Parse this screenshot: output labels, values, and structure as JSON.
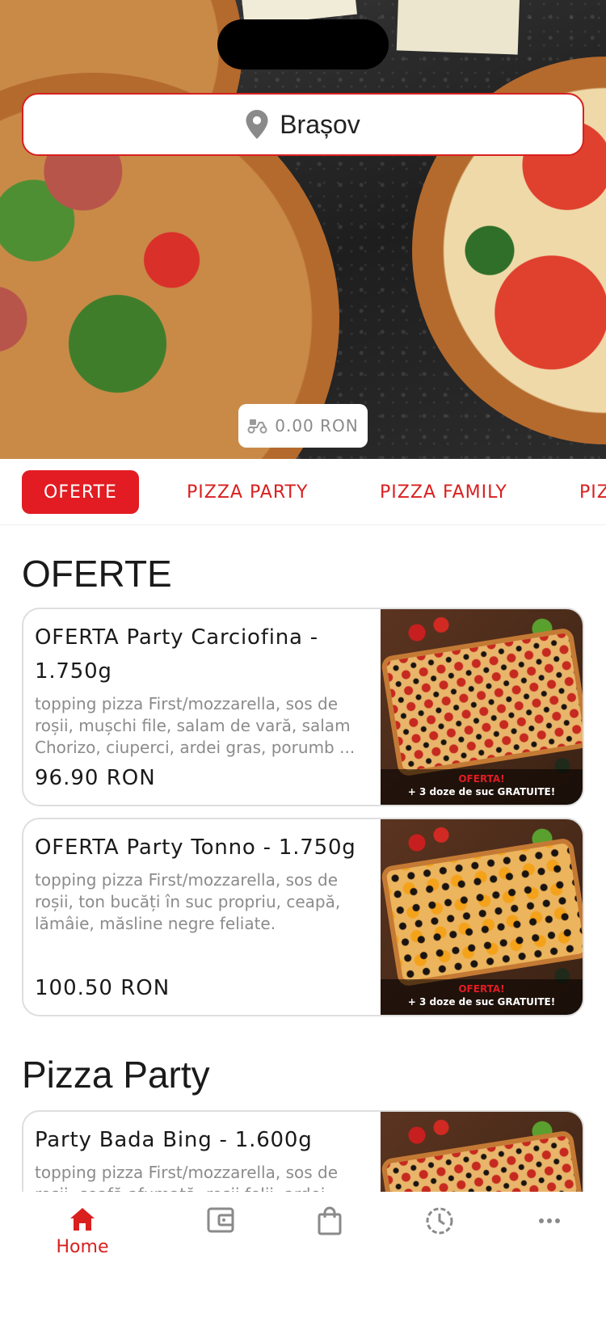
{
  "header": {
    "city": "Brașov",
    "cart_amount": "0.00 RON"
  },
  "tabs": [
    {
      "label": "OFERTE",
      "active": true
    },
    {
      "label": "PIZZA PARTY",
      "active": false
    },
    {
      "label": "PIZZA FAMILY",
      "active": false
    },
    {
      "label": "PIZ",
      "active": false
    }
  ],
  "sections": [
    {
      "title": "OFERTE",
      "products": [
        {
          "name": "OFERTA Party Carciofina - 1.750g",
          "description": "topping pizza First/mozzarella, sos de roșii, mușchi file, salam de vară, salam Chorizo, ciuperci, ardei gras, porumb ...",
          "price": "96.90 RON",
          "promo_line1": "OFERTA!",
          "promo_line2": "+ 3 doze de suc GRATUITE!"
        },
        {
          "name": "OFERTA Party Tonno - 1.750g",
          "description": "topping pizza First/mozzarella, sos de roșii, ton bucăți în suc propriu, ceapă, lămâie, măsline negre feliate.",
          "price": "100.50 RON",
          "promo_line1": "OFERTA!",
          "promo_line2": "+ 3 doze de suc GRATUITE!"
        }
      ]
    },
    {
      "title": "Pizza Party",
      "products": [
        {
          "name": "Party Bada Bing - 1.600g",
          "description": "topping pizza First/mozzarella, sos de roșii, ceafă afumată, roșii felii, ardei"
        }
      ]
    }
  ],
  "bottom_nav": [
    {
      "icon": "home-icon",
      "label": "Home",
      "active": true
    },
    {
      "icon": "wallet-icon",
      "label": ""
    },
    {
      "icon": "shopping-bag-icon",
      "label": ""
    },
    {
      "icon": "history-clock-icon",
      "label": ""
    },
    {
      "icon": "more-icon",
      "label": ""
    }
  ],
  "colors": {
    "accent": "#e21c22",
    "accent_text": "#d9201f",
    "muted_text": "#8b8b8b"
  }
}
